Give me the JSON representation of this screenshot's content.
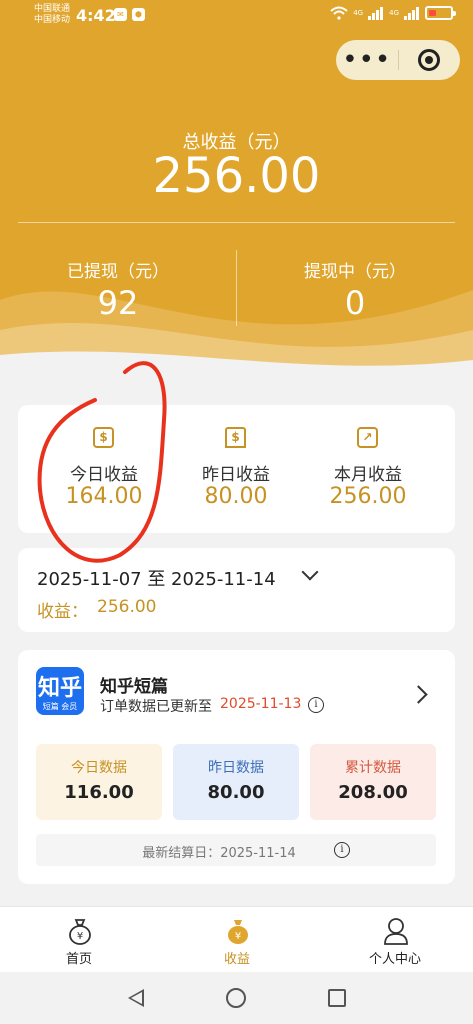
{
  "status_bar": {
    "carrier_1": "中国联通",
    "carrier_2": "中国移动",
    "time": "4:42",
    "network_1": "4G",
    "network_2": "4G"
  },
  "header": {
    "total_label": "总收益（元）",
    "total_value": "256.00",
    "withdrawn_label": "已提现（元）",
    "withdrawn_value": "92",
    "withdrawing_label": "提现中（元）",
    "withdrawing_value": "0"
  },
  "stats": {
    "today": {
      "label": "今日收益",
      "value": "164.00",
      "icon": "dollar-icon"
    },
    "yesterday": {
      "label": "昨日收益",
      "value": "80.00",
      "icon": "monitor-dollar-icon"
    },
    "month": {
      "label": "本月收益",
      "value": "256.00",
      "icon": "chart-up-icon"
    }
  },
  "date_filter": {
    "range": "2025-11-07 至 2025-11-14",
    "income_label": "收益：",
    "income_value": "256.00"
  },
  "app": {
    "logo_text": "知乎",
    "logo_sub": "短篇 会员",
    "name": "知乎短篇",
    "update_label": "订单数据已更新至",
    "update_date": "2025-11-13",
    "metrics": {
      "today_label": "今日数据",
      "today_value": "116.00",
      "yesterday_label": "昨日数据",
      "yesterday_value": "80.00",
      "total_label": "累计数据",
      "total_value": "208.00"
    },
    "settle_text": "最新结算日：2025-11-14"
  },
  "tabbar": {
    "home": "首页",
    "income": "收益",
    "profile": "个人中心"
  },
  "colors": {
    "header_bg": "#e0a52c",
    "accent": "#c79224",
    "highlight_red": "#e04b2a"
  }
}
